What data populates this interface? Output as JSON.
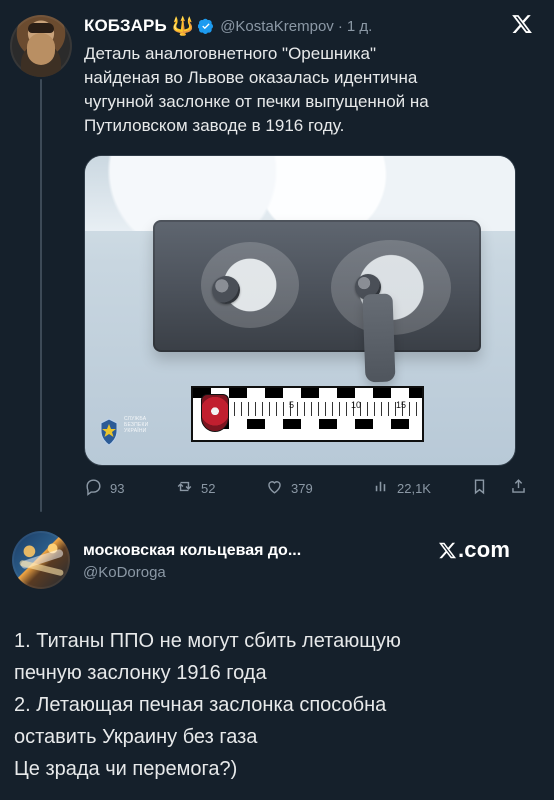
{
  "top_tweet": {
    "author": {
      "display_name": "КОБЗАРЬ",
      "name_emoji": "🔱",
      "verified_badge_color": "#1d9bf0",
      "handle": "@KostaKrempov",
      "separator": "·",
      "time": "1 д."
    },
    "text": "Деталь аналоговнетного \"Орешника\"\nнайденая во Львове оказалась идентична\nчугунной заслонке от печки выпущенной на\nПутиловском заводе в 1916 году.",
    "media": {
      "ruler_numbers": [
        "5",
        "10",
        "15"
      ],
      "watermark_text": "СЛУЖБА\nБЕЗПЕКИ\nУКРАЇНИ"
    },
    "actions": {
      "replies": "93",
      "reposts": "52",
      "likes": "379",
      "views": "22,1K"
    }
  },
  "bottom_card": {
    "author": {
      "display_name": "московская кольцевая до...",
      "handle": "@KoDoroga"
    },
    "brand": ".com",
    "text": "1. Титаны ППО не могут сбить летающую\nпечную заслонку 1916 года\n2. Летающая печная заслонка способна\nоставить Украину без газа\nЦе зрада чи перемога?)"
  },
  "colors": {
    "background": "#15202b",
    "primary_text": "#e7e9ea",
    "secondary_text": "#8b98a5",
    "accent_blue": "#1d9bf0",
    "accent_gold": "#f0c419"
  },
  "icons": {
    "close": "x-logo-icon",
    "reply": "reply-icon",
    "retweet": "retweet-icon",
    "like": "heart-icon",
    "views": "views-bar-icon",
    "bookmark": "bookmark-icon",
    "share": "share-icon",
    "verified": "verified-badge-icon",
    "sbu": "shield-emblem-icon"
  }
}
